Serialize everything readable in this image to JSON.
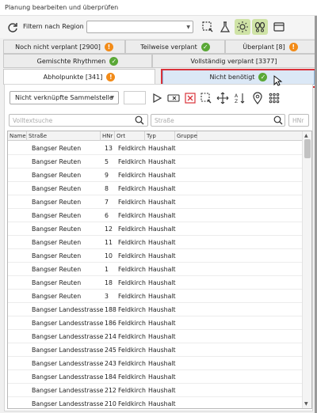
{
  "window": {
    "title": "Planung bearbeiten und überprüfen"
  },
  "toolbar": {
    "filter_label": "Filtern nach Region",
    "region_value": "",
    "icons": [
      "refresh-icon",
      "lasso-select-icon",
      "flask-icon",
      "sun-settings-icon",
      "footprints-icon",
      "window-icon"
    ]
  },
  "tabs": {
    "row1": [
      {
        "label": "Noch nicht verplant [2900]",
        "badge": "!",
        "status": "warn"
      },
      {
        "label": "Teilweise verplant",
        "badge": "✓",
        "status": "ok"
      },
      {
        "label": "Überplant [8]",
        "badge": "!",
        "status": "warn"
      }
    ],
    "row2": [
      {
        "label": "Gemischte Rhythmen",
        "badge": "✓",
        "status": "ok"
      },
      {
        "label": "Vollständig verplant [3377]",
        "badge": "",
        "status": ""
      }
    ],
    "row3": [
      {
        "label": "Abholpunkte [341]",
        "badge": "!",
        "status": "warn"
      },
      {
        "label": "Nicht benötigt",
        "badge": "✓",
        "status": "ok"
      }
    ]
  },
  "panel": {
    "sammel_select": "Nicht verknüpfte Sammelstelle",
    "search_fulltext_placeholder": "Volltextsuche",
    "search_street_placeholder": "Straße",
    "search_hnr_placeholder": "HNr"
  },
  "grid": {
    "columns": [
      "Name",
      "Straße",
      "HNr",
      "Ort",
      "Typ",
      "Gruppe"
    ],
    "rows": [
      [
        "",
        "Bangser Reuten",
        "13",
        "Feldkirch",
        "Haushalt",
        ""
      ],
      [
        "",
        "Bangser Reuten",
        "5",
        "Feldkirch",
        "Haushalt",
        ""
      ],
      [
        "",
        "Bangser Reuten",
        "9",
        "Feldkirch",
        "Haushalt",
        ""
      ],
      [
        "",
        "Bangser Reuten",
        "8",
        "Feldkirch",
        "Haushalt",
        ""
      ],
      [
        "",
        "Bangser Reuten",
        "7",
        "Feldkirch",
        "Haushalt",
        ""
      ],
      [
        "",
        "Bangser Reuten",
        "6",
        "Feldkirch",
        "Haushalt",
        ""
      ],
      [
        "",
        "Bangser Reuten",
        "12",
        "Feldkirch",
        "Haushalt",
        ""
      ],
      [
        "",
        "Bangser Reuten",
        "11",
        "Feldkirch",
        "Haushalt",
        ""
      ],
      [
        "",
        "Bangser Reuten",
        "10",
        "Feldkirch",
        "Haushalt",
        ""
      ],
      [
        "",
        "Bangser Reuten",
        "1",
        "Feldkirch",
        "Haushalt",
        ""
      ],
      [
        "",
        "Bangser Reuten",
        "18",
        "Feldkirch",
        "Haushalt",
        ""
      ],
      [
        "",
        "Bangser Reuten",
        "3",
        "Feldkirch",
        "Haushalt",
        ""
      ],
      [
        "",
        "Bangser Landesstrasse",
        "188",
        "Feldkirch",
        "Haushalt",
        ""
      ],
      [
        "",
        "Bangser Landesstrasse",
        "186",
        "Feldkirch",
        "Haushalt",
        ""
      ],
      [
        "",
        "Bangser Landesstrasse",
        "214",
        "Feldkirch",
        "Haushalt",
        ""
      ],
      [
        "",
        "Bangser Landesstrasse",
        "245",
        "Feldkirch",
        "Haushalt",
        ""
      ],
      [
        "",
        "Bangser Landesstrasse",
        "243",
        "Feldkirch",
        "Haushalt",
        ""
      ],
      [
        "",
        "Bangser Landesstrasse",
        "184",
        "Feldkirch",
        "Haushalt",
        ""
      ],
      [
        "",
        "Bangser Landesstrasse",
        "212",
        "Feldkirch",
        "Haushalt",
        ""
      ],
      [
        "",
        "Bangser Landesstrasse",
        "210",
        "Feldkirch",
        "Haushalt",
        ""
      ]
    ]
  },
  "colors": {
    "warn": "#f28b18",
    "ok": "#5aa836",
    "selected_tab": "#dbe8f6",
    "highlight": "#d9323a",
    "delete_red": "#d9323a"
  }
}
